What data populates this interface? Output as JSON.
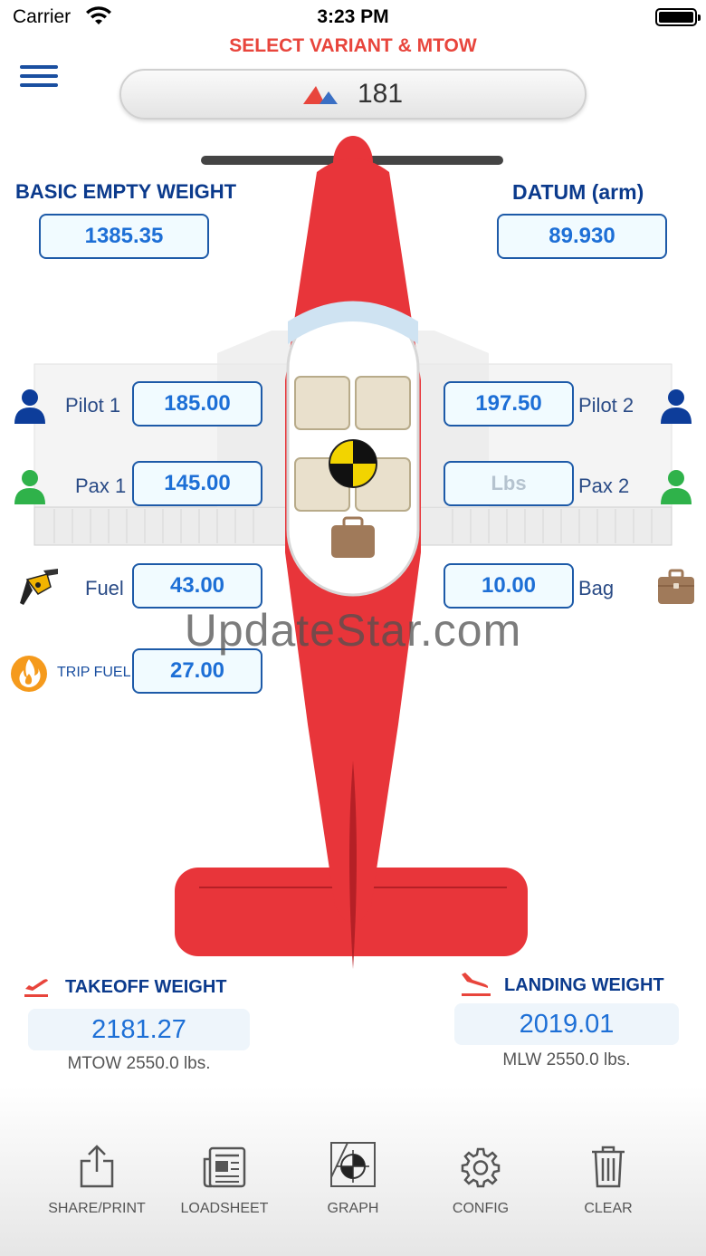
{
  "status": {
    "carrier": "Carrier",
    "time": "3:23 PM"
  },
  "header": {
    "variant_label": "SELECT VARIANT & MTOW",
    "variant_value": "181"
  },
  "basic_empty_weight": {
    "label": "BASIC EMPTY WEIGHT",
    "value": "1385.35"
  },
  "datum": {
    "label": "DATUM (arm)",
    "value": "89.930"
  },
  "stations": {
    "pilot1": {
      "label": "Pilot 1",
      "value": "185.00"
    },
    "pilot2": {
      "label": "Pilot 2",
      "value": "197.50"
    },
    "pax1": {
      "label": "Pax 1",
      "value": "145.00"
    },
    "pax2": {
      "label": "Pax 2",
      "placeholder": "Lbs"
    },
    "fuel": {
      "label": "Fuel",
      "value": "43.00"
    },
    "bag": {
      "label": "Bag",
      "value": "10.00"
    },
    "trip_fuel": {
      "label": "TRIP FUEL",
      "value": "27.00"
    }
  },
  "takeoff": {
    "label": "TAKEOFF WEIGHT",
    "value": "2181.27",
    "limit": "MTOW 2550.0 lbs."
  },
  "landing": {
    "label": "LANDING WEIGHT",
    "value": "2019.01",
    "limit": "MLW 2550.0 lbs."
  },
  "watermark": "UpdateStar.com",
  "toolbar": {
    "share": "SHARE/PRINT",
    "loadsheet": "LOADSHEET",
    "graph": "GRAPH",
    "config": "CONFIG",
    "clear": "CLEAR"
  },
  "colors": {
    "accent_red": "#e8453c",
    "navy": "#0b3a8c",
    "value_blue": "#1d6fd6",
    "pilot_icon": "#0d3d9a",
    "pax_icon": "#2fb24a"
  },
  "icons": {
    "menu": "hamburger-icon",
    "pilot": "person-icon",
    "fuel": "fuel-nozzle-icon",
    "trip_fuel": "flame-icon",
    "bag": "briefcase-icon",
    "takeoff": "takeoff-icon",
    "landing": "landing-icon"
  }
}
